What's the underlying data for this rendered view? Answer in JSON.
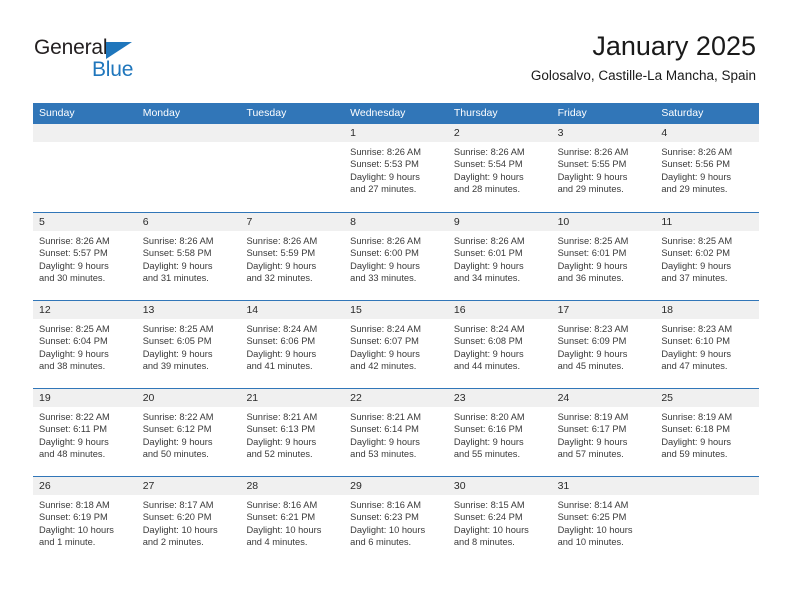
{
  "brand": {
    "name_part1": "General",
    "name_part2": "Blue"
  },
  "header": {
    "title": "January 2025",
    "subtitle": "Golosalvo, Castille-La Mancha, Spain",
    "accent_color": "#3176b8"
  },
  "weekdays": [
    "Sunday",
    "Monday",
    "Tuesday",
    "Wednesday",
    "Thursday",
    "Friday",
    "Saturday"
  ],
  "weeks": [
    [
      {
        "day": "",
        "lines": []
      },
      {
        "day": "",
        "lines": []
      },
      {
        "day": "",
        "lines": []
      },
      {
        "day": "1",
        "lines": [
          "Sunrise: 8:26 AM",
          "Sunset: 5:53 PM",
          "Daylight: 9 hours",
          "and 27 minutes."
        ]
      },
      {
        "day": "2",
        "lines": [
          "Sunrise: 8:26 AM",
          "Sunset: 5:54 PM",
          "Daylight: 9 hours",
          "and 28 minutes."
        ]
      },
      {
        "day": "3",
        "lines": [
          "Sunrise: 8:26 AM",
          "Sunset: 5:55 PM",
          "Daylight: 9 hours",
          "and 29 minutes."
        ]
      },
      {
        "day": "4",
        "lines": [
          "Sunrise: 8:26 AM",
          "Sunset: 5:56 PM",
          "Daylight: 9 hours",
          "and 29 minutes."
        ]
      }
    ],
    [
      {
        "day": "5",
        "lines": [
          "Sunrise: 8:26 AM",
          "Sunset: 5:57 PM",
          "Daylight: 9 hours",
          "and 30 minutes."
        ]
      },
      {
        "day": "6",
        "lines": [
          "Sunrise: 8:26 AM",
          "Sunset: 5:58 PM",
          "Daylight: 9 hours",
          "and 31 minutes."
        ]
      },
      {
        "day": "7",
        "lines": [
          "Sunrise: 8:26 AM",
          "Sunset: 5:59 PM",
          "Daylight: 9 hours",
          "and 32 minutes."
        ]
      },
      {
        "day": "8",
        "lines": [
          "Sunrise: 8:26 AM",
          "Sunset: 6:00 PM",
          "Daylight: 9 hours",
          "and 33 minutes."
        ]
      },
      {
        "day": "9",
        "lines": [
          "Sunrise: 8:26 AM",
          "Sunset: 6:01 PM",
          "Daylight: 9 hours",
          "and 34 minutes."
        ]
      },
      {
        "day": "10",
        "lines": [
          "Sunrise: 8:25 AM",
          "Sunset: 6:01 PM",
          "Daylight: 9 hours",
          "and 36 minutes."
        ]
      },
      {
        "day": "11",
        "lines": [
          "Sunrise: 8:25 AM",
          "Sunset: 6:02 PM",
          "Daylight: 9 hours",
          "and 37 minutes."
        ]
      }
    ],
    [
      {
        "day": "12",
        "lines": [
          "Sunrise: 8:25 AM",
          "Sunset: 6:04 PM",
          "Daylight: 9 hours",
          "and 38 minutes."
        ]
      },
      {
        "day": "13",
        "lines": [
          "Sunrise: 8:25 AM",
          "Sunset: 6:05 PM",
          "Daylight: 9 hours",
          "and 39 minutes."
        ]
      },
      {
        "day": "14",
        "lines": [
          "Sunrise: 8:24 AM",
          "Sunset: 6:06 PM",
          "Daylight: 9 hours",
          "and 41 minutes."
        ]
      },
      {
        "day": "15",
        "lines": [
          "Sunrise: 8:24 AM",
          "Sunset: 6:07 PM",
          "Daylight: 9 hours",
          "and 42 minutes."
        ]
      },
      {
        "day": "16",
        "lines": [
          "Sunrise: 8:24 AM",
          "Sunset: 6:08 PM",
          "Daylight: 9 hours",
          "and 44 minutes."
        ]
      },
      {
        "day": "17",
        "lines": [
          "Sunrise: 8:23 AM",
          "Sunset: 6:09 PM",
          "Daylight: 9 hours",
          "and 45 minutes."
        ]
      },
      {
        "day": "18",
        "lines": [
          "Sunrise: 8:23 AM",
          "Sunset: 6:10 PM",
          "Daylight: 9 hours",
          "and 47 minutes."
        ]
      }
    ],
    [
      {
        "day": "19",
        "lines": [
          "Sunrise: 8:22 AM",
          "Sunset: 6:11 PM",
          "Daylight: 9 hours",
          "and 48 minutes."
        ]
      },
      {
        "day": "20",
        "lines": [
          "Sunrise: 8:22 AM",
          "Sunset: 6:12 PM",
          "Daylight: 9 hours",
          "and 50 minutes."
        ]
      },
      {
        "day": "21",
        "lines": [
          "Sunrise: 8:21 AM",
          "Sunset: 6:13 PM",
          "Daylight: 9 hours",
          "and 52 minutes."
        ]
      },
      {
        "day": "22",
        "lines": [
          "Sunrise: 8:21 AM",
          "Sunset: 6:14 PM",
          "Daylight: 9 hours",
          "and 53 minutes."
        ]
      },
      {
        "day": "23",
        "lines": [
          "Sunrise: 8:20 AM",
          "Sunset: 6:16 PM",
          "Daylight: 9 hours",
          "and 55 minutes."
        ]
      },
      {
        "day": "24",
        "lines": [
          "Sunrise: 8:19 AM",
          "Sunset: 6:17 PM",
          "Daylight: 9 hours",
          "and 57 minutes."
        ]
      },
      {
        "day": "25",
        "lines": [
          "Sunrise: 8:19 AM",
          "Sunset: 6:18 PM",
          "Daylight: 9 hours",
          "and 59 minutes."
        ]
      }
    ],
    [
      {
        "day": "26",
        "lines": [
          "Sunrise: 8:18 AM",
          "Sunset: 6:19 PM",
          "Daylight: 10 hours",
          "and 1 minute."
        ]
      },
      {
        "day": "27",
        "lines": [
          "Sunrise: 8:17 AM",
          "Sunset: 6:20 PM",
          "Daylight: 10 hours",
          "and 2 minutes."
        ]
      },
      {
        "day": "28",
        "lines": [
          "Sunrise: 8:16 AM",
          "Sunset: 6:21 PM",
          "Daylight: 10 hours",
          "and 4 minutes."
        ]
      },
      {
        "day": "29",
        "lines": [
          "Sunrise: 8:16 AM",
          "Sunset: 6:23 PM",
          "Daylight: 10 hours",
          "and 6 minutes."
        ]
      },
      {
        "day": "30",
        "lines": [
          "Sunrise: 8:15 AM",
          "Sunset: 6:24 PM",
          "Daylight: 10 hours",
          "and 8 minutes."
        ]
      },
      {
        "day": "31",
        "lines": [
          "Sunrise: 8:14 AM",
          "Sunset: 6:25 PM",
          "Daylight: 10 hours",
          "and 10 minutes."
        ]
      },
      {
        "day": "",
        "lines": []
      }
    ]
  ]
}
